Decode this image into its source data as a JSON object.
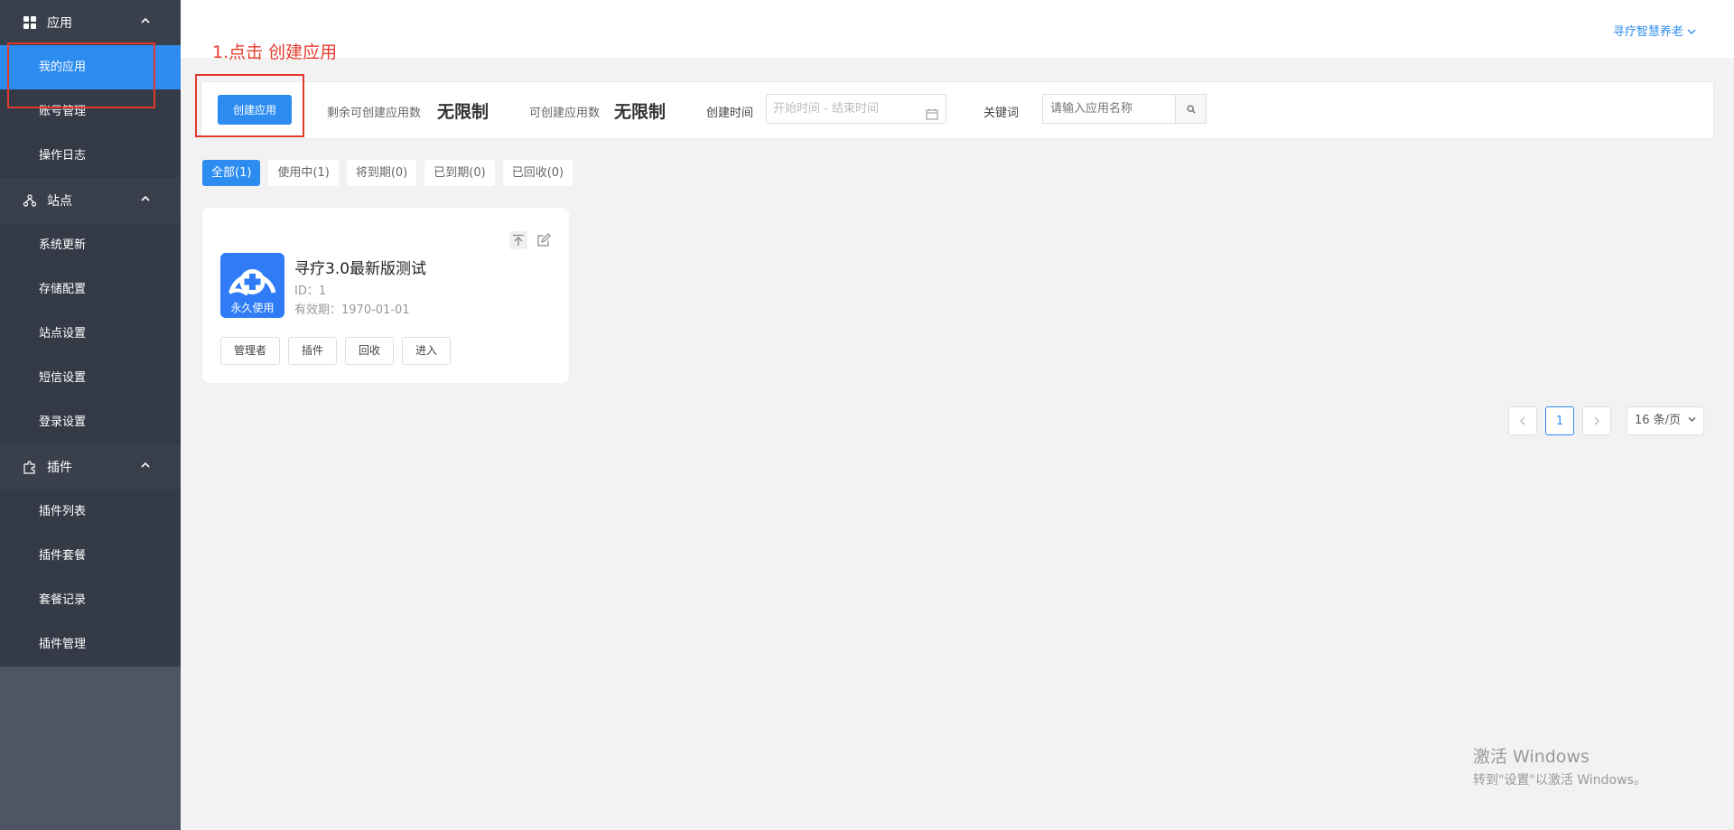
{
  "sidebar": {
    "groups": [
      {
        "title": "应用",
        "icon": "grid-icon",
        "items": [
          {
            "label": "我的应用",
            "active": true
          },
          {
            "label": "账号管理"
          },
          {
            "label": "操作日志"
          }
        ]
      },
      {
        "title": "站点",
        "icon": "sitemap-icon",
        "items": [
          {
            "label": "系统更新"
          },
          {
            "label": "存储配置"
          },
          {
            "label": "站点设置"
          },
          {
            "label": "短信设置"
          },
          {
            "label": "登录设置"
          }
        ]
      },
      {
        "title": "插件",
        "icon": "puzzle-icon",
        "items": [
          {
            "label": "插件列表"
          },
          {
            "label": "插件套餐"
          },
          {
            "label": "套餐记录"
          },
          {
            "label": "插件管理"
          }
        ]
      }
    ]
  },
  "header": {
    "user": "寻疗智慧养老"
  },
  "annotation": {
    "step": "1.点击 创建应用"
  },
  "toolbar": {
    "create_label": "创建应用",
    "remaining_label": "剩余可创建应用数",
    "remaining_value": "无限制",
    "creatable_label": "可创建应用数",
    "creatable_value": "无限制",
    "date_label": "创建时间",
    "date_placeholder": "开始时间 - 结束时间",
    "keyword_label": "关键词",
    "keyword_placeholder": "请输入应用名称"
  },
  "filters": [
    {
      "label": "全部(1)",
      "active": true
    },
    {
      "label": "使用中(1)"
    },
    {
      "label": "将到期(0)"
    },
    {
      "label": "已到期(0)"
    },
    {
      "label": "已回收(0)"
    }
  ],
  "app_card": {
    "name": "寻疗3.0最新版测试",
    "id": "ID：1",
    "expiry": "有效期：1970-01-01",
    "badge": "永久使用",
    "buttons": [
      "管理者",
      "插件",
      "回收",
      "进入"
    ]
  },
  "pagination": {
    "current": "1",
    "page_size": "16 条/页"
  },
  "watermark": {
    "line1": "激活 Windows",
    "line2": "转到\"设置\"以激活 Windows。"
  },
  "colors": {
    "primary": "#2d8cf0",
    "sidebar": "#4f5564",
    "annotation": "#e83b2e"
  }
}
